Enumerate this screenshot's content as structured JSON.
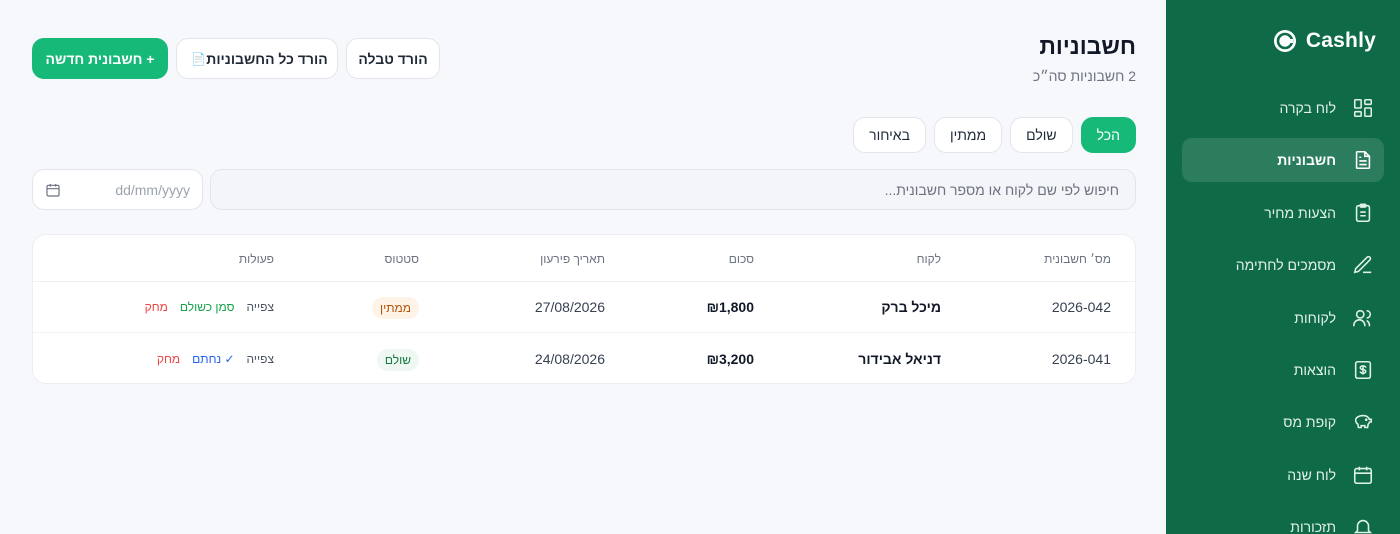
{
  "brand": {
    "name": "Cashly"
  },
  "sidebar": {
    "items": [
      {
        "label": "לוח בקרה",
        "icon": "dashboard-icon",
        "active": false
      },
      {
        "label": "חשבוניות",
        "icon": "document-icon",
        "active": true
      },
      {
        "label": "הצעות מחיר",
        "icon": "clipboard-icon",
        "active": false
      },
      {
        "label": "מסמכים לחתימה",
        "icon": "pen-icon",
        "active": false
      },
      {
        "label": "לקוחות",
        "icon": "users-icon",
        "active": false
      },
      {
        "label": "הוצאות",
        "icon": "dollar-receipt-icon",
        "active": false
      },
      {
        "label": "קופת מס",
        "icon": "piggy-bank-icon",
        "active": false
      },
      {
        "label": "לוח שנה",
        "icon": "calendar-icon",
        "active": false
      },
      {
        "label": "תזכורות",
        "icon": "bell-icon",
        "active": false
      }
    ]
  },
  "header": {
    "title": "חשבוניות",
    "subtitle": "2 חשבוניות סה״כ",
    "new_invoice_label": "+ חשבונית חדשה",
    "download_all_label": "הורד כל החשבוניות",
    "download_all_glyph": "📄",
    "download_table_label": "הורד טבלה"
  },
  "filters": {
    "tabs": [
      "הכל",
      "שולם",
      "ממתין",
      "באיחור"
    ],
    "active_index": 0
  },
  "search": {
    "placeholder": "חיפוש לפי שם לקוח או מספר חשבונית..."
  },
  "date_filter": {
    "placeholder": "dd/mm/yyyy"
  },
  "table": {
    "headers": {
      "number": "מס׳ חשבונית",
      "client": "לקוח",
      "amount": "סכום",
      "due_date": "תאריך פירעון",
      "status": "סטטוס",
      "actions": "פעולות"
    },
    "rows": [
      {
        "number": "2026-042",
        "client": "מיכל ברק",
        "amount": "₪1,800",
        "due_date": "27/08/2026",
        "status": "ממתין",
        "status_kind": "pending",
        "actions": {
          "view": "צפייה",
          "primary": "סמן כשולם",
          "delete": "מחק"
        }
      },
      {
        "number": "2026-041",
        "client": "דניאל אבידור",
        "amount": "₪3,200",
        "due_date": "24/08/2026",
        "status": "שולם",
        "status_kind": "paid",
        "actions": {
          "view": "צפייה",
          "primary": "✓ נחתם",
          "delete": "מחק"
        }
      }
    ]
  },
  "colors": {
    "sidebar": "#0f6b47",
    "accent": "#17b978",
    "pending": "#b45309",
    "paid": "#137a45",
    "danger": "#ef4444",
    "link": "#2563eb"
  }
}
